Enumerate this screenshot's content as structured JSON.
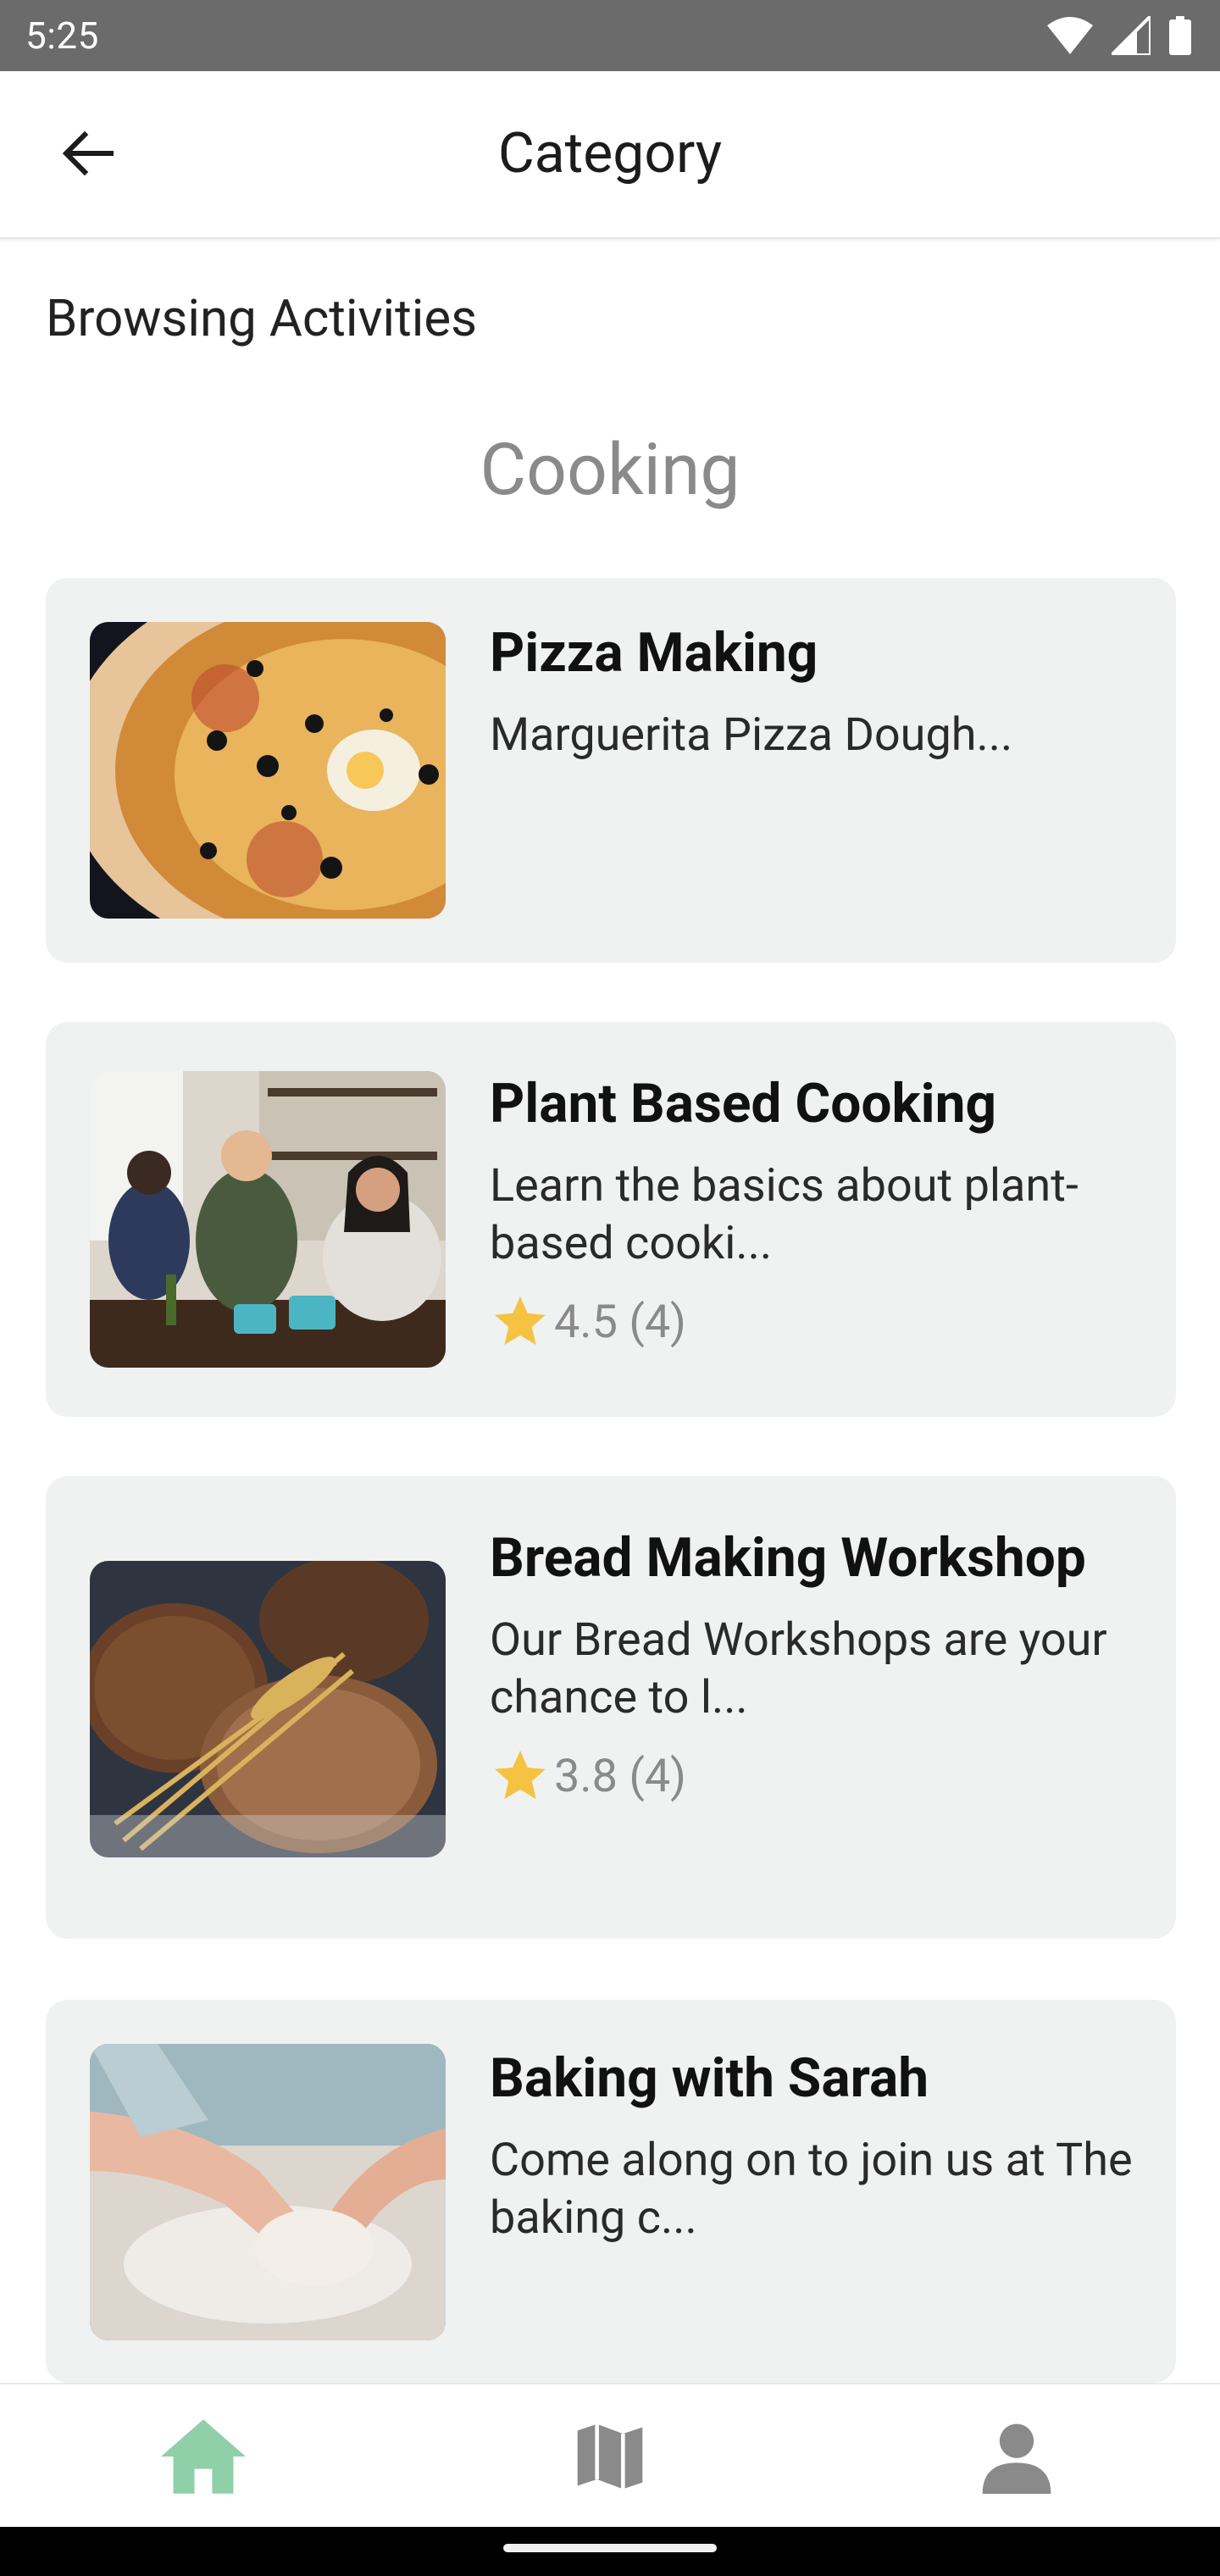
{
  "status_bar": {
    "time": "5:25"
  },
  "app_bar": {
    "title": "Category"
  },
  "page": {
    "section_label": "Browsing Activities",
    "category": "Cooking"
  },
  "activities": [
    {
      "title": "Pizza Making",
      "description": "Marguerita Pizza Dough...",
      "image": "pizza-photo"
    },
    {
      "title": "Plant Based Cooking",
      "description": "Learn the basics about plant-based cooki...",
      "rating": "4.5",
      "reviews": "(4)",
      "image": "kitchen-cooking-photo"
    },
    {
      "title": "Bread Making Workshop",
      "description": "Our Bread Workshops are your chance to l...",
      "rating": "3.8",
      "reviews": "(4)",
      "image": "bread-loaves-photo"
    },
    {
      "title": "Baking with Sarah",
      "description": "Come along on to join us at The baking c...",
      "image": "kneading-dough-photo"
    }
  ],
  "bottom_nav": [
    {
      "icon": "home-icon",
      "active": true
    },
    {
      "icon": "map-icon",
      "active": false
    },
    {
      "icon": "profile-icon",
      "active": false
    }
  ],
  "colors": {
    "accent": "#8fd0a8",
    "star": "#f5c242",
    "card_bg": "#f0f1f1",
    "status_bar": "#6b6b6b"
  }
}
